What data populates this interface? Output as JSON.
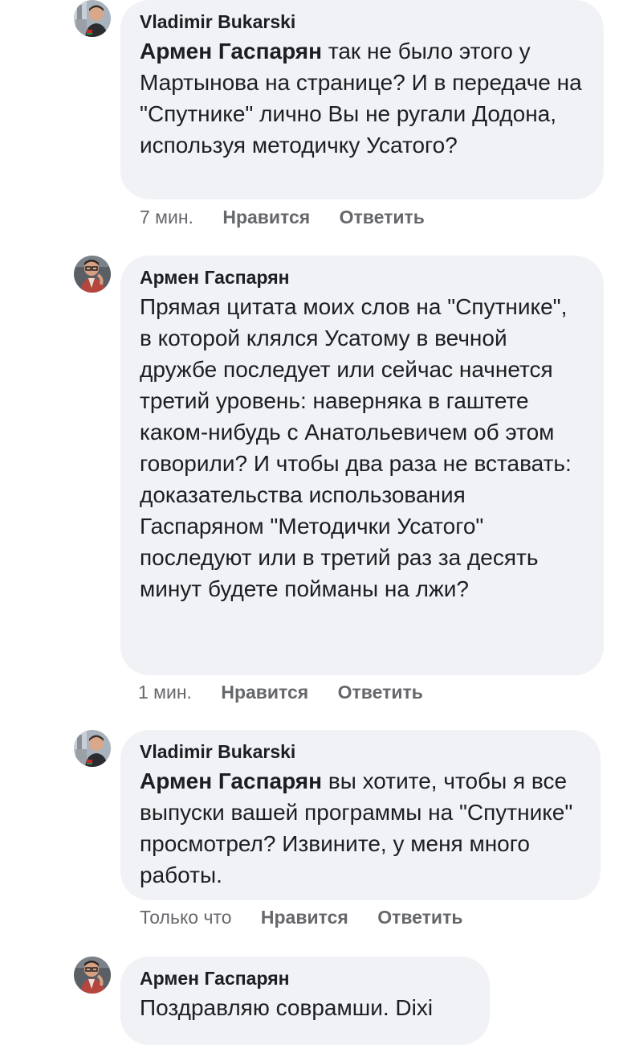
{
  "comments": [
    {
      "author": "Vladimir Bukarski",
      "mention": "Армен Гаспарян",
      "text": " так не было этого у Мартынова на странице? И в передаче на \"Спутнике\" лично Вы не ругали Додона, используя методичку Усатого?",
      "time": "7 мин.",
      "like": "Нравится",
      "reply": "Ответить"
    },
    {
      "author": "Армен Гаспарян",
      "mention": "",
      "text": "Прямая цитата моих слов на \"Спутнике\", в которой  клялся Усатому в вечной дружбе последует или сейчас начнется третий уровень: наверняка в гаштете каком-нибудь с Анатольевичем об этом говорили? И чтобы два раза не вставать: доказательства использования Гаспаряном \"Методички Усатого\" последуют или в третий раз за десять минут будете пойманы на лжи?",
      "time": "1 мин.",
      "like": "Нравится",
      "reply": "Ответить"
    },
    {
      "author": "Vladimir Bukarski",
      "mention": "Армен Гаспарян",
      "text": " вы хотите, чтобы я все выпуски вашей программы на \"Спутнике\" просмотрел? Извините, у меня много работы.",
      "time": "Только что",
      "like": "Нравится",
      "reply": "Ответить"
    },
    {
      "author": "Армен Гаспарян",
      "mention": "",
      "text": "Поздравляю соврамши. Dixi"
    }
  ],
  "colors": {
    "bubble": "#f0f2f5",
    "text": "#1c1e21",
    "meta": "#65676b"
  }
}
